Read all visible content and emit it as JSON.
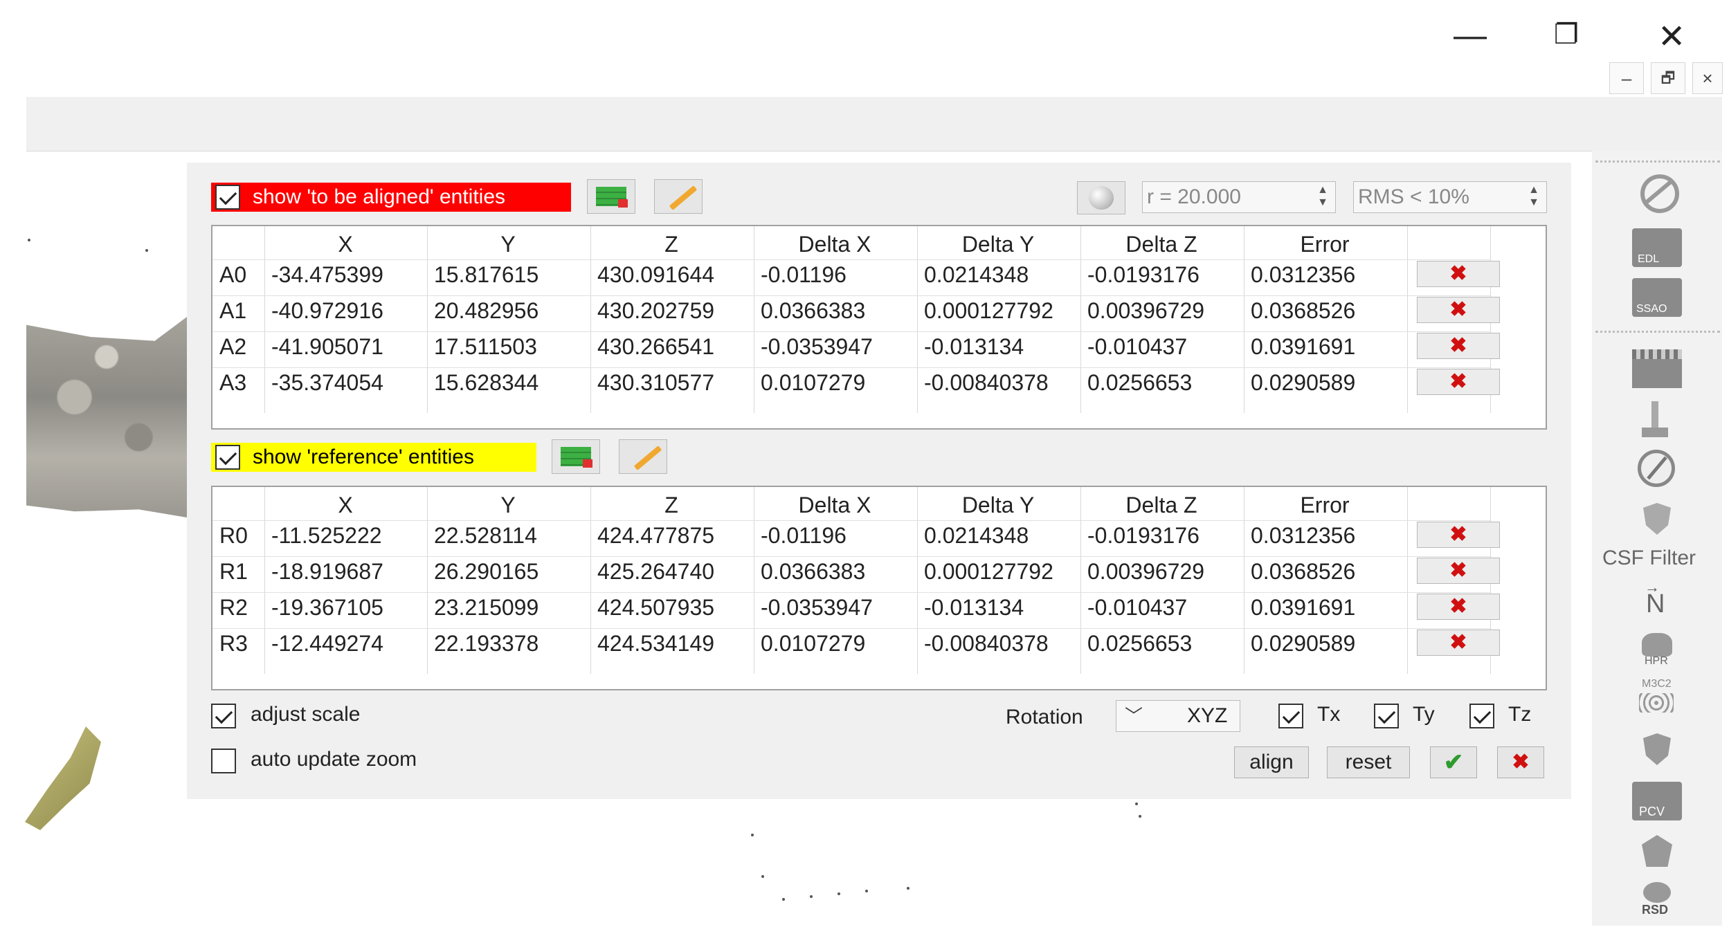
{
  "window": {
    "minimize_icon": "—",
    "restore_icon": "❐",
    "close_icon": "✕",
    "mdi_minimize": "–",
    "mdi_restore": "🗗",
    "mdi_close": "×"
  },
  "aligned": {
    "label": "show 'to be aligned' entities",
    "checked": true,
    "columns": [
      "X",
      "Y",
      "Z",
      "Delta X",
      "Delta Y",
      "Delta Z",
      "Error"
    ],
    "rows": [
      {
        "id": "A0",
        "values": [
          "-34.475399",
          "15.817615",
          "430.091644",
          "-0.01196",
          "0.0214348",
          "-0.0193176",
          "0.0312356"
        ]
      },
      {
        "id": "A1",
        "values": [
          "-40.972916",
          "20.482956",
          "430.202759",
          "0.0366383",
          "0.000127792",
          "0.00396729",
          "0.0368526"
        ]
      },
      {
        "id": "A2",
        "values": [
          "-41.905071",
          "17.511503",
          "430.266541",
          "-0.0353947",
          "-0.013134",
          "-0.010437",
          "0.0391691"
        ]
      },
      {
        "id": "A3",
        "values": [
          "-35.374054",
          "15.628344",
          "430.310577",
          "0.0107279",
          "-0.00840378",
          "0.0256653",
          "0.0290589"
        ]
      }
    ]
  },
  "reference": {
    "label": "show 'reference' entities",
    "checked": true,
    "columns": [
      "X",
      "Y",
      "Z",
      "Delta X",
      "Delta Y",
      "Delta Z",
      "Error"
    ],
    "rows": [
      {
        "id": "R0",
        "values": [
          "-11.525222",
          "22.528114",
          "424.477875",
          "-0.01196",
          "0.0214348",
          "-0.0193176",
          "0.0312356"
        ]
      },
      {
        "id": "R1",
        "values": [
          "-18.919687",
          "26.290165",
          "425.264740",
          "0.0366383",
          "0.000127792",
          "0.00396729",
          "0.0368526"
        ]
      },
      {
        "id": "R2",
        "values": [
          "-19.367105",
          "23.215099",
          "424.507935",
          "-0.0353947",
          "-0.013134",
          "-0.010437",
          "0.0391691"
        ]
      },
      {
        "id": "R3",
        "values": [
          "-12.449274",
          "22.193378",
          "424.534149",
          "0.0107279",
          "-0.00840378",
          "0.0256653",
          "0.0290589"
        ]
      }
    ]
  },
  "delete_glyph": "✖",
  "radius": {
    "value": "r = 20.000"
  },
  "rms": {
    "value": "RMS < 10%"
  },
  "options": {
    "adjust_scale": "adjust scale",
    "auto_update_zoom": "auto update zoom",
    "rotation_label": "Rotation",
    "rotation_value": "XYZ",
    "tx": "Tx",
    "ty": "Ty",
    "tz": "Tz"
  },
  "buttons": {
    "align": "align",
    "reset": "reset",
    "ok_glyph": "✔",
    "cancel_glyph": "✖"
  },
  "side_panel": {
    "edl": "EDL",
    "ssao": "SSAO",
    "csf": "CSF Filter",
    "north": "N",
    "hpr": "HPR",
    "m3c2": "M3C2",
    "pcv": "PCV",
    "rsd": "RSD"
  },
  "colors": {
    "aligned_highlight": "#ff0000",
    "reference_highlight": "#ffff00",
    "delete_red": "#d01010",
    "ok_green": "#2e9b2e"
  }
}
